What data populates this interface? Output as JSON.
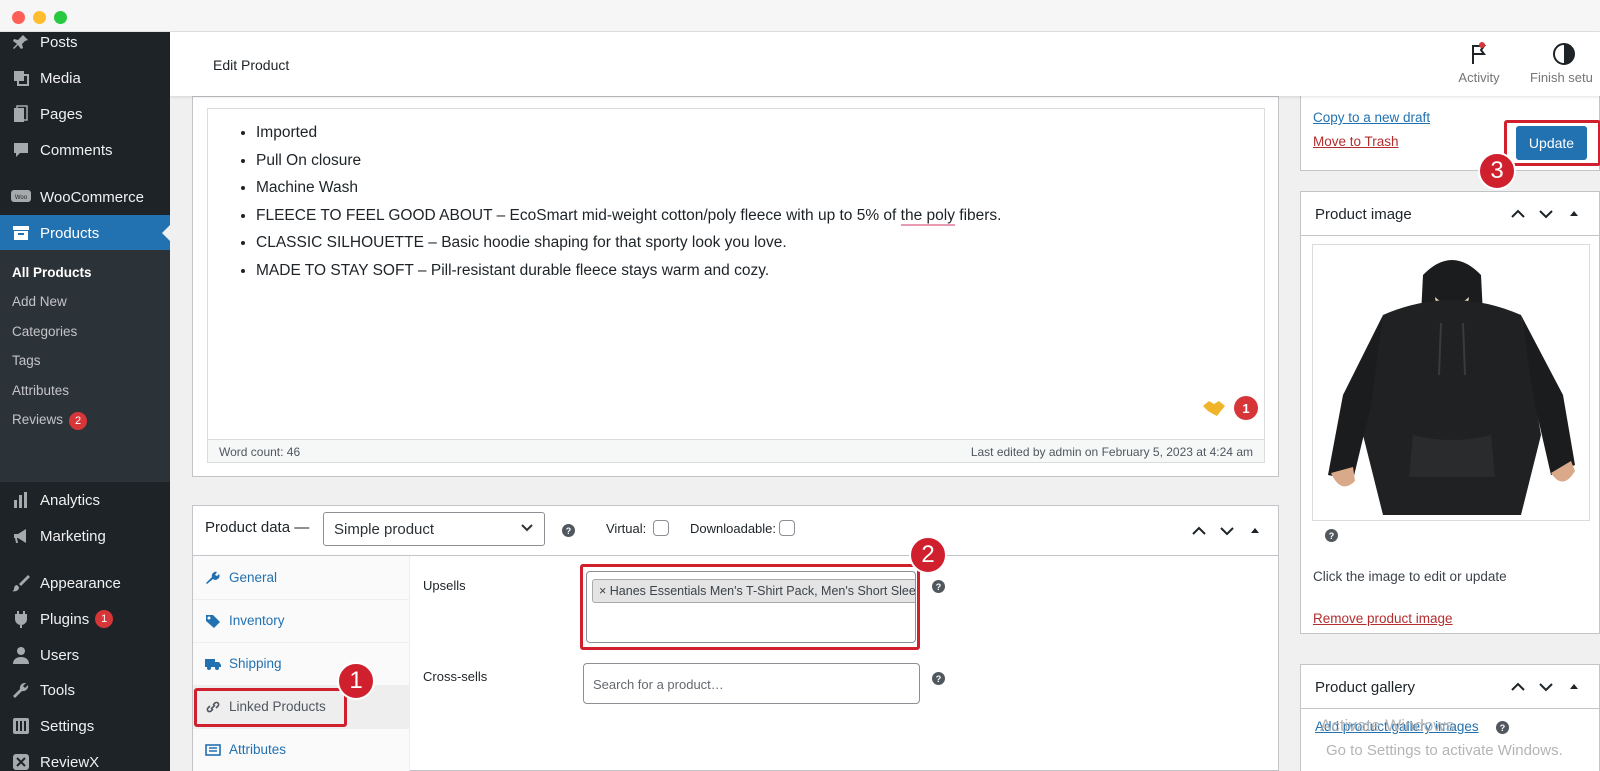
{
  "sidebar": {
    "items": [
      {
        "label": "Posts",
        "icon": "pin-icon"
      },
      {
        "label": "Media",
        "icon": "media-icon"
      },
      {
        "label": "Pages",
        "icon": "page-icon"
      },
      {
        "label": "Comments",
        "icon": "comment-icon"
      },
      {
        "label": "WooCommerce",
        "icon": "woo-icon"
      },
      {
        "label": "Products",
        "icon": "archive-icon"
      },
      {
        "label": "Analytics",
        "icon": "bar-chart-icon"
      },
      {
        "label": "Marketing",
        "icon": "megaphone-icon"
      },
      {
        "label": "Appearance",
        "icon": "paintbrush-icon"
      },
      {
        "label": "Plugins",
        "icon": "plug-icon",
        "badge": "1"
      },
      {
        "label": "Users",
        "icon": "user-icon"
      },
      {
        "label": "Tools",
        "icon": "wrench-icon"
      },
      {
        "label": "Settings",
        "icon": "settings-icon"
      },
      {
        "label": "ReviewX",
        "icon": "reviewx-icon"
      }
    ],
    "submenu": [
      {
        "label": "All Products"
      },
      {
        "label": "Add New"
      },
      {
        "label": "Categories"
      },
      {
        "label": "Tags"
      },
      {
        "label": "Attributes"
      },
      {
        "label": "Reviews",
        "badge": "2"
      }
    ]
  },
  "header": {
    "title": "Edit Product",
    "activity_label": "Activity",
    "finish_label": "Finish setu"
  },
  "editor": {
    "bullets": [
      "Imported",
      "Pull On closure",
      "Machine Wash",
      "FLEECE TO FEEL GOOD ABOUT – EcoSmart mid-weight cotton/poly fleece with up to 5% of ",
      "CLASSIC SILHOUETTE – Basic hoodie shaping for that sporty look you love.",
      "MADE TO STAY SOFT – Pill-resistant durable fleece stays warm and cozy."
    ],
    "bullet4_misspelled": "the poly",
    "bullet4_tail": " fibers.",
    "word_count": "Word count: 46",
    "last_edited": "Last edited by admin on February 5, 2023 at 4:24 am",
    "grammar_count": "1"
  },
  "product_data": {
    "title": "Product data —",
    "type_value": "Simple product",
    "virtual_label": "Virtual:",
    "downloadable_label": "Downloadable:",
    "tabs": [
      {
        "label": "General",
        "icon": "wrench-icon"
      },
      {
        "label": "Inventory",
        "icon": "tag-icon"
      },
      {
        "label": "Shipping",
        "icon": "truck-icon"
      },
      {
        "label": "Linked Products",
        "icon": "link-icon"
      },
      {
        "label": "Attributes",
        "icon": "list-icon"
      }
    ],
    "upsells_label": "Upsells",
    "upsell_chip": "× Hanes Essentials Men's T-Shirt Pack, Men's Short Sleeve",
    "crosssells_label": "Cross-sells",
    "crosssells_placeholder": "Search for a product…"
  },
  "publish": {
    "copy_draft": "Copy to a new draft",
    "trash": "Move to Trash",
    "update": "Update"
  },
  "product_image": {
    "title": "Product image",
    "hint": "Click the image to edit or update",
    "remove": "Remove product image"
  },
  "gallery": {
    "title": "Product gallery",
    "add": "Add product gallery images"
  },
  "watermark": {
    "line1": "Activate Windows",
    "line2": "Go to Settings to activate Windows."
  },
  "annotations": [
    "1",
    "2",
    "3"
  ],
  "colors": {
    "sidebar_bg": "#1d2327",
    "accent": "#2271b1",
    "annotation": "#d0202e"
  }
}
